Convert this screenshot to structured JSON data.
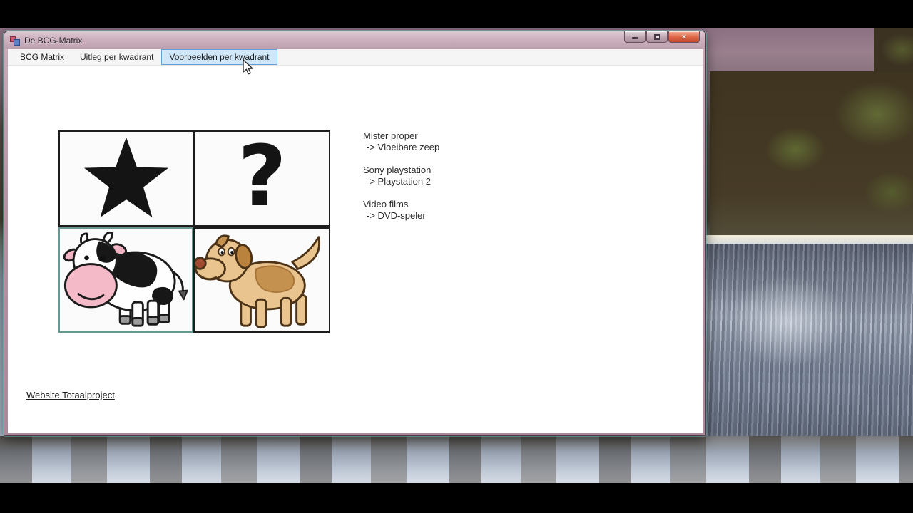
{
  "window": {
    "title": "De BCG-Matrix",
    "controls": {
      "close_glyph": "×"
    }
  },
  "menu": {
    "items": [
      "BCG Matrix",
      "Uitleg per kwadrant",
      "Voorbeelden per kwadrant"
    ],
    "active_item": "Voorbeelden per kwadrant"
  },
  "matrix": {
    "question_mark": "?",
    "quadrant_icons": [
      "star-icon",
      "question-mark-glyph",
      "cash-cow-image",
      "dog-image"
    ]
  },
  "examples": [
    {
      "product": "Mister proper",
      "result": "-> Vloeibare zeep"
    },
    {
      "product": "Sony playstation",
      "result": "-> Playstation 2"
    },
    {
      "product": "Video films",
      "result": "-> DVD-speler"
    }
  ],
  "footer": {
    "link_label": "Website Totaalproject"
  },
  "colors": {
    "menu_highlight_bg": "#cfe7f8",
    "menu_highlight_border": "#66a0d0",
    "cow_box_border": "#639b94",
    "titlebar_tint": "#b493a4",
    "close_button_red": "#d6573a"
  }
}
